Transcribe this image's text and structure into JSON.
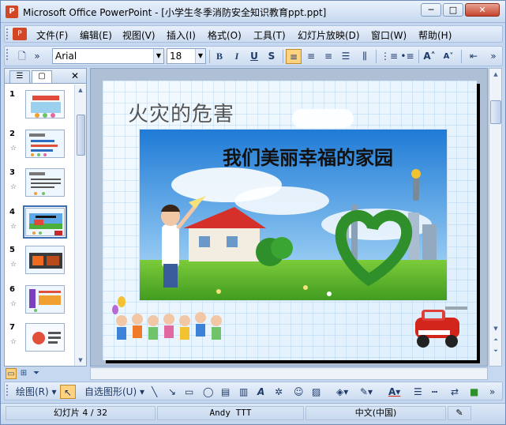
{
  "window": {
    "title": "Microsoft Office PowerPoint - [小学生冬季消防安全知识教育ppt.ppt]",
    "min_label": "─",
    "max_label": "□",
    "close_label": "✕"
  },
  "menu": [
    "文件(F)",
    "编辑(E)",
    "视图(V)",
    "插入(I)",
    "格式(O)",
    "工具(T)",
    "幻灯片放映(D)",
    "窗口(W)",
    "帮助(H)"
  ],
  "toolbar": {
    "font_name": "Arial",
    "font_size": "18",
    "bold": "B",
    "italic": "I",
    "underline": "U",
    "shadow": "S"
  },
  "thumbnails": [
    {
      "num": "1",
      "star": ""
    },
    {
      "num": "2",
      "star": "☆"
    },
    {
      "num": "3",
      "star": "☆"
    },
    {
      "num": "4",
      "star": "☆",
      "selected": true
    },
    {
      "num": "5",
      "star": "☆"
    },
    {
      "num": "6",
      "star": "☆"
    },
    {
      "num": "7",
      "star": "☆"
    }
  ],
  "slide": {
    "title": "火灾的危害",
    "caption": "我们美丽幸福的家园"
  },
  "drawbar": {
    "draw_label": "绘图(R)",
    "autoshape_label": "自选图形(U)"
  },
  "status": {
    "slide_info": "幻灯片 4 / 32",
    "design": "Andy TTT",
    "language": "中文(中国)"
  },
  "colors": {
    "accent": "#d24726",
    "selection": "#ffd280",
    "chrome": "#c5d8f0"
  }
}
